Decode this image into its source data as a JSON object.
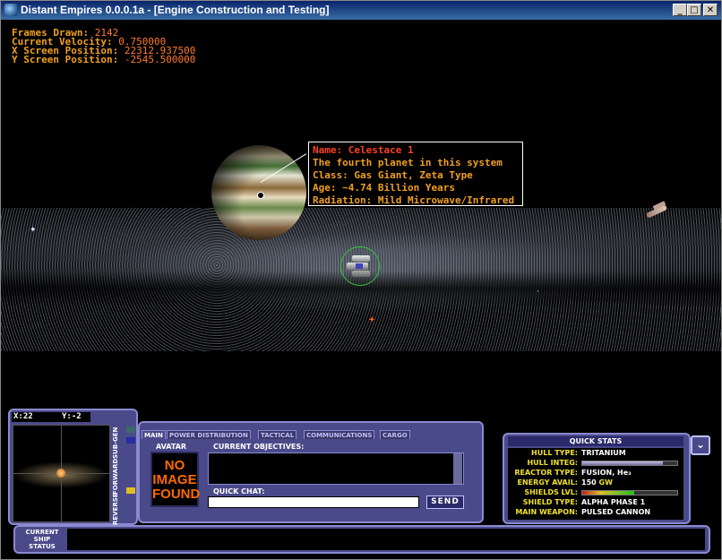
{
  "window": {
    "title": "Distant Empires 0.0.0.1a - [Engine Construction and Testing]",
    "minimize": "_",
    "maximize": "□",
    "close": "✕"
  },
  "hud": {
    "frames_label": "Frames Drawn:",
    "frames_value": "2142",
    "velocity_label": "Current Velocity:",
    "velocity_value": "0.750000",
    "xpos_label": "X Screen Position:",
    "xpos_value": "22312.937500",
    "ypos_label": "Y Screen Position:",
    "ypos_value": "-2545.500000"
  },
  "planet_info": {
    "name_label": "Name:",
    "name_value": "Celestace 1",
    "description": "The fourth planet in this system",
    "class": "Class: Gas Giant, Zeta Type",
    "age": "Age: ~4.74 Billion Years",
    "radiation": "Radiation: Mild Microwave/Infrared"
  },
  "radar": {
    "x_label": "X:",
    "x_value": "22",
    "y_label": "Y:",
    "y_value": "-2",
    "sub_gen": "SUB-GEN",
    "forward": "FORWARD",
    "reverse": "REVERSE"
  },
  "tabs": [
    {
      "label": "MAIN",
      "active": true
    },
    {
      "label": "POWER DISTRIBUTION"
    },
    {
      "label": "TACTICAL"
    },
    {
      "label": "COMMUNICATIONS"
    },
    {
      "label": "CARGO"
    }
  ],
  "main": {
    "avatar_label": "AVATAR",
    "avatar_placeholder_1": "NO",
    "avatar_placeholder_2": "IMAGE",
    "avatar_placeholder_3": "FOUND",
    "objectives_label": "CURRENT OBJECTIVES:",
    "chat_label": "QUICK CHAT:",
    "chat_value": "",
    "send_label": "SEND"
  },
  "quick_stats": {
    "title": "QUICK STATS",
    "hull_type_label": "HULL TYPE:",
    "hull_type_value": "TRITANIUM",
    "hull_integ_label": "HULL INTEG:",
    "hull_integ_fraction": 0.85,
    "reactor_label": "REACTOR TYPE:",
    "reactor_value": "FUSION, He₃",
    "energy_label": "ENERGY AVAIL:",
    "energy_value": "150",
    "energy_unit": "GW",
    "shields_lvl_label": "SHIELDS LVL:",
    "shields_lvl_fraction": 0.55,
    "shield_type_label": "SHIELD TYPE:",
    "shield_type_value": "ALPHA PHASE 1",
    "weapon_label": "MAIN WEAPON:",
    "weapon_value": "PULSED CANNON"
  },
  "status": {
    "label_1": "CURRENT",
    "label_2": "SHIP",
    "label_3": "STATUS"
  },
  "colors": {
    "hud_orange": "#f0a020",
    "panel_blue": "#4a4a8a",
    "stat_yellow": "#f0e030"
  }
}
